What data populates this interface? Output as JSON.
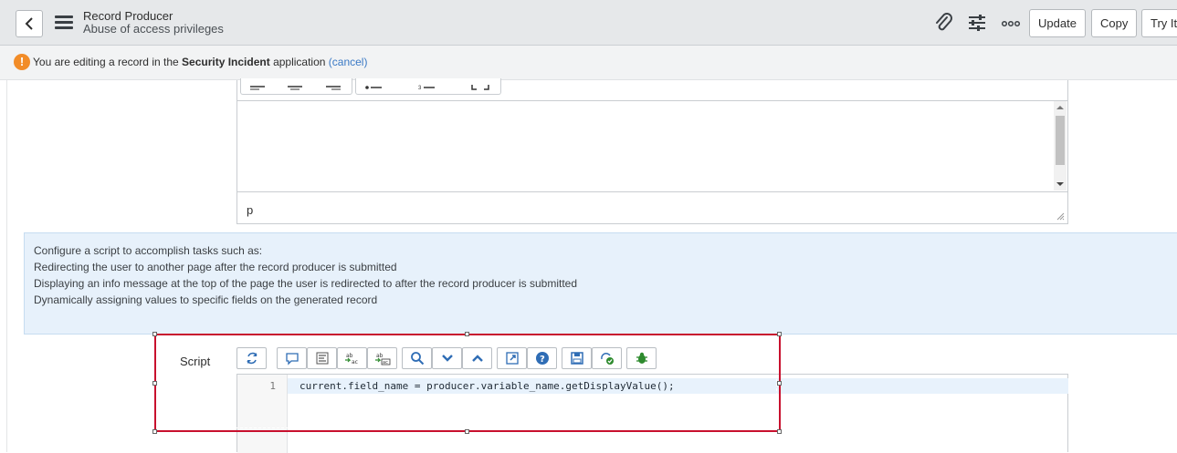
{
  "header": {
    "title": "Record Producer",
    "subtitle": "Abuse of access privileges",
    "buttons": {
      "update": "Update",
      "copy": "Copy",
      "try_it": "Try It"
    },
    "icons": {
      "back": "chevron-left-icon",
      "menu": "hamburger-icon",
      "attach": "paperclip-icon",
      "settings": "sliders-icon",
      "more": "more-options-icon"
    }
  },
  "info_bar": {
    "prefix": "You are editing a record in the",
    "app_name": "Security Incident",
    "suffix": "application",
    "cancel": "(cancel)"
  },
  "html_editor": {
    "status_text": "p"
  },
  "help_text": {
    "lines": [
      "Configure a script to accomplish tasks such as:",
      "Redirecting the user to another page after the record producer is submitted",
      "Displaying an info message at the top of the page the user is redirected to after the record producer is submitted",
      "Dynamically assigning values to specific fields on the generated record"
    ]
  },
  "script_field": {
    "label": "Script",
    "line_number": "1",
    "code": "current.field_name = producer.variable_name.getDisplayValue();"
  },
  "colors": {
    "accent_link": "#3a79c5",
    "highlight_border": "#c8102e",
    "warning": "#f28c28",
    "help_bg": "#e7f1fb"
  }
}
